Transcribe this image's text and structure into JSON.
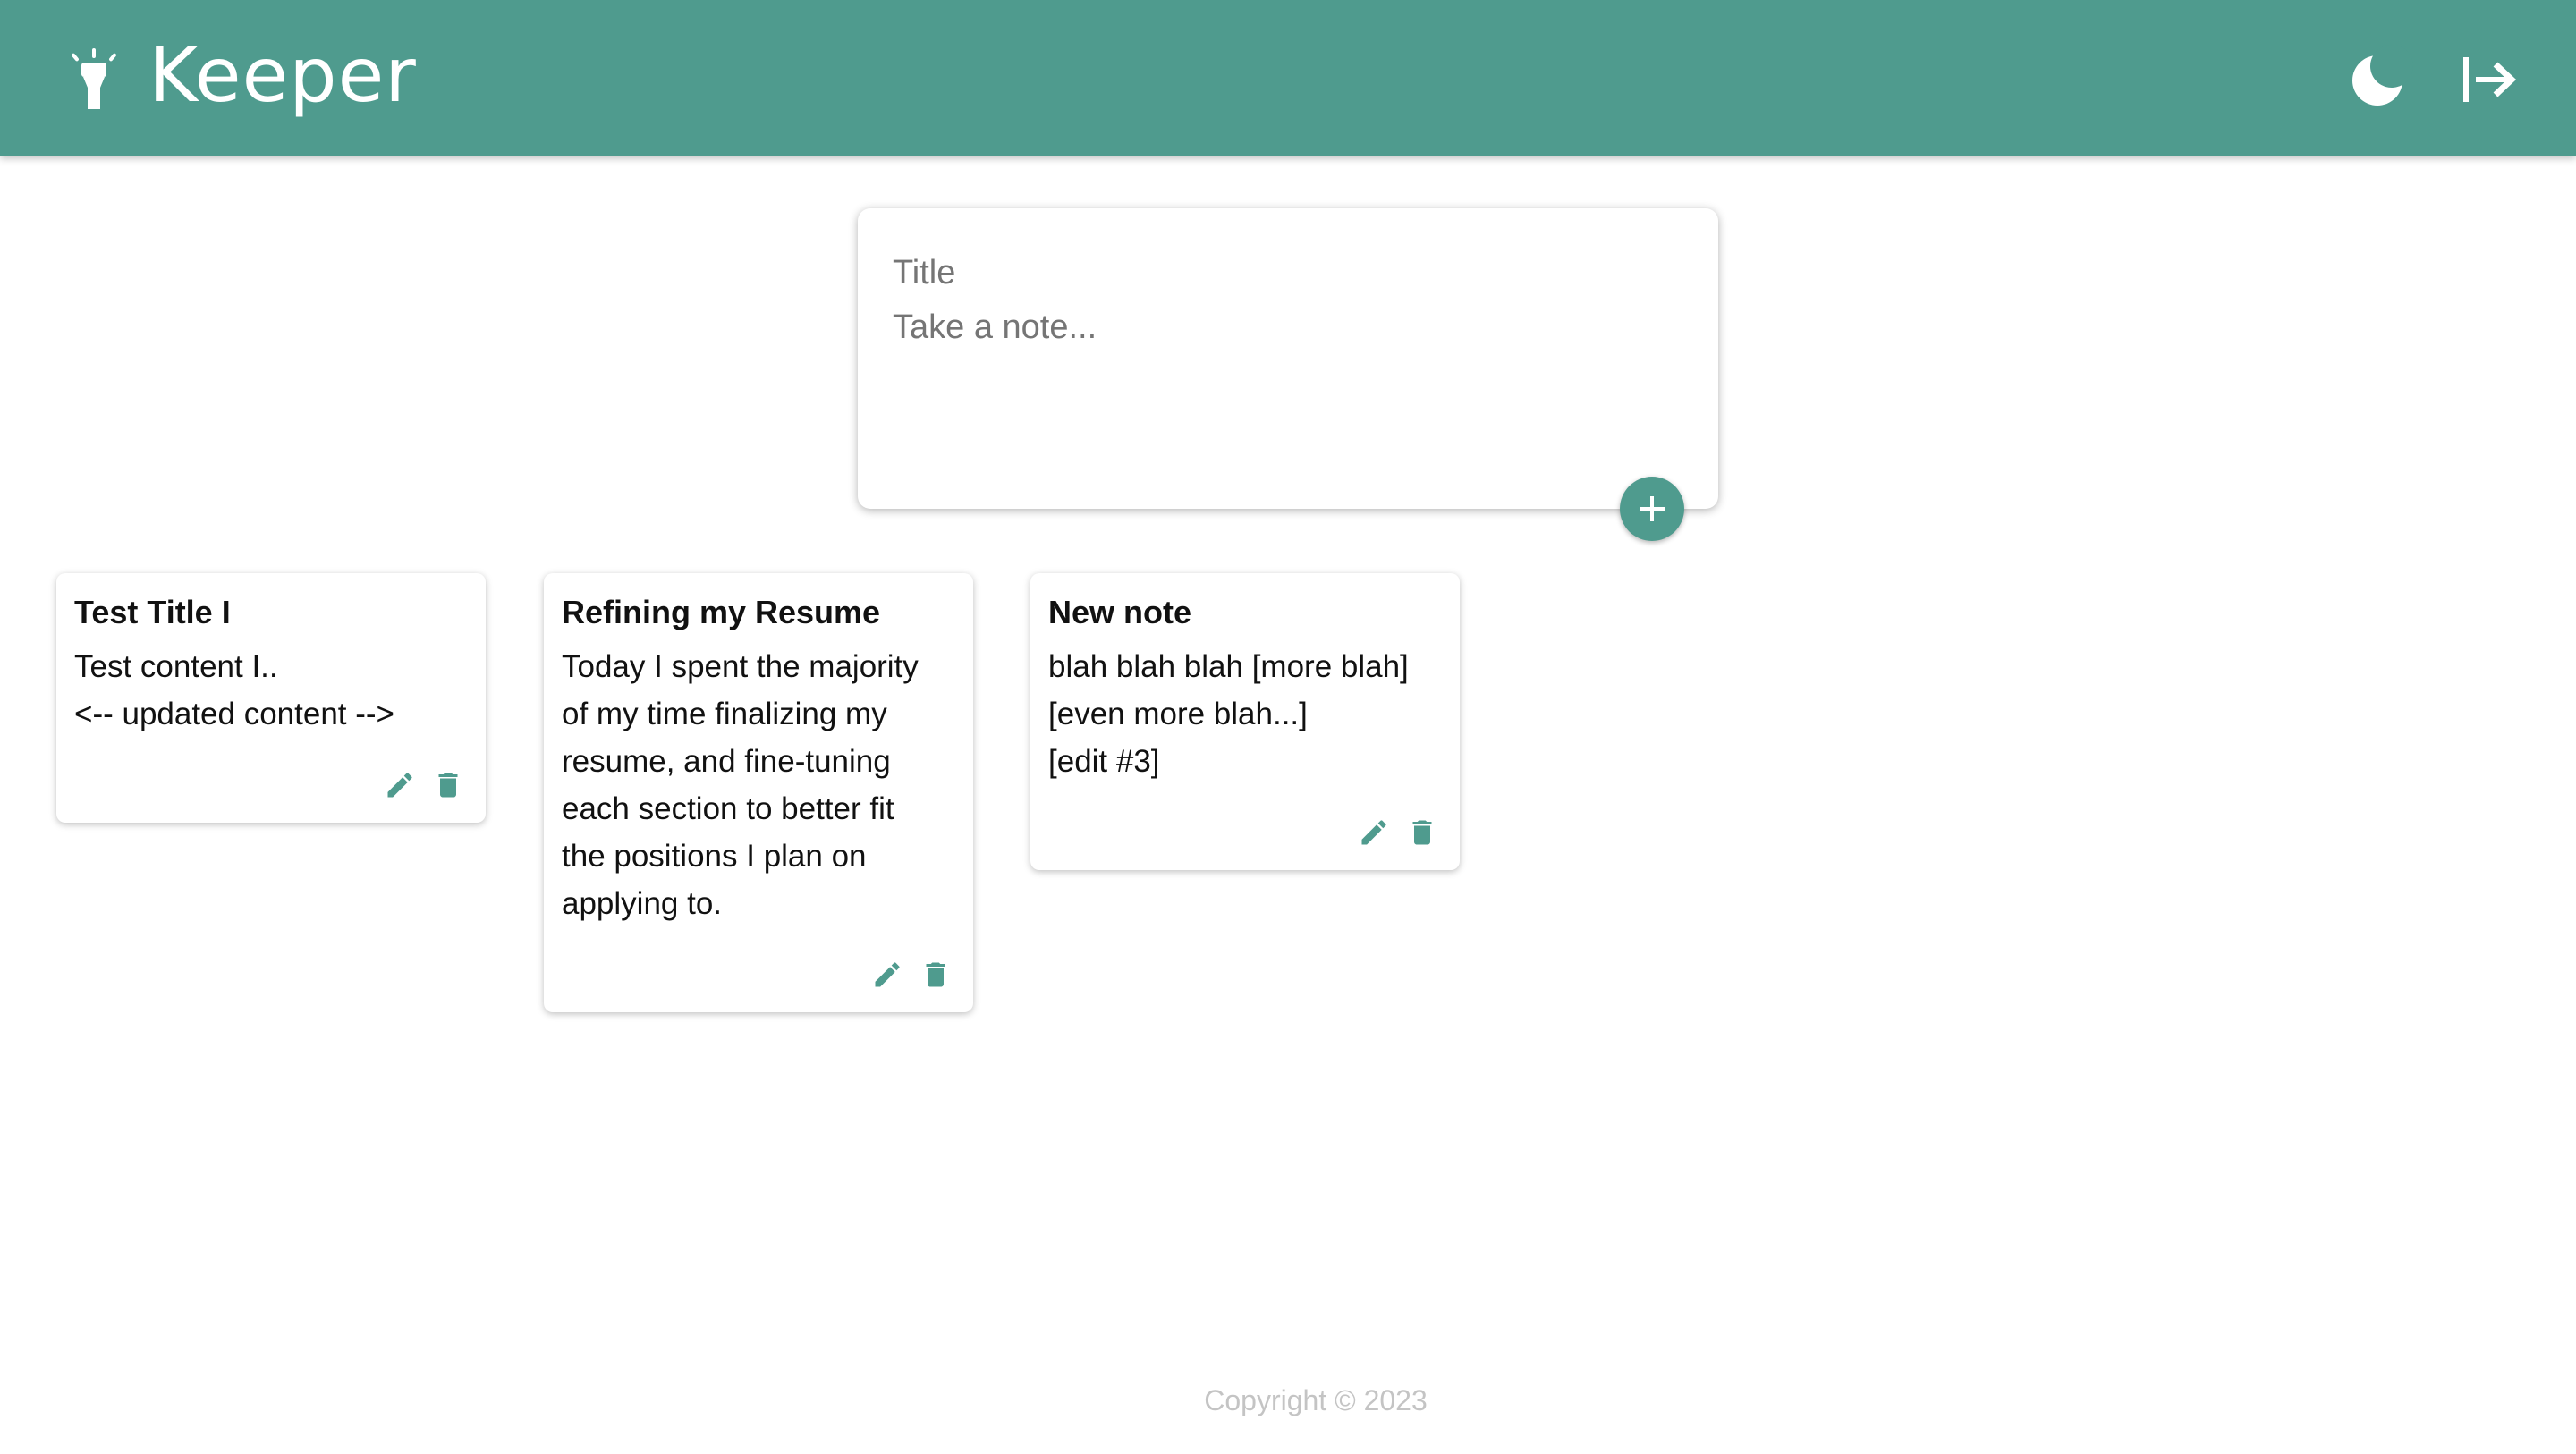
{
  "app": {
    "title": "Keeper",
    "accent": "#4f9b8e"
  },
  "header": {
    "icons": [
      "flashlight-icon",
      "moon-icon",
      "logout-icon"
    ]
  },
  "composer": {
    "title_placeholder": "Title",
    "content_placeholder": "Take a note...",
    "add_icon": "plus-icon"
  },
  "notes": [
    {
      "title": "Test Title I",
      "content": "Test content I..\n<-- updated content -->"
    },
    {
      "title": "Refining my Resume",
      "content": "Today I spent the majority\nof my time finalizing my\nresume, and fine-tuning\neach section to better fit\nthe positions I plan on\napplying to."
    },
    {
      "title": "New note",
      "content": "blah blah blah [more blah]\n[even more blah...]\n[edit #3]"
    }
  ],
  "footer": {
    "text": "Copyright © 2023"
  }
}
